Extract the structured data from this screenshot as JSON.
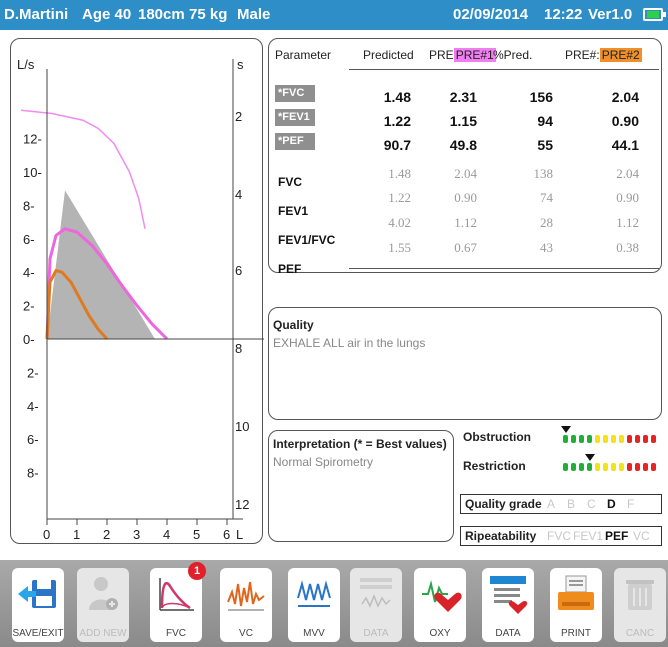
{
  "header": {
    "patient_name": "D.Martini",
    "age": "Age 40",
    "height": "180cm",
    "weight": "75 kg",
    "sex": "Male",
    "date": "02/09/2014",
    "time": "12:22",
    "version": "Ver1.0"
  },
  "chart_data": {
    "type": "line",
    "left_axis": {
      "unit_label": "L/s",
      "ticks_upper": [
        "12-",
        "10-",
        "8-",
        "6-",
        "4-",
        "2-",
        "0-"
      ],
      "ticks_lower": [
        "2-",
        "4-",
        "6-",
        "8-"
      ]
    },
    "right_axis": {
      "unit_label": "s",
      "ticks": [
        "2",
        "4",
        "6",
        "8",
        "10",
        "12"
      ]
    },
    "x_axis": {
      "ticks": [
        "0",
        "1",
        "2",
        "3",
        "4",
        "5",
        "6"
      ],
      "unit_label": "L"
    },
    "xlim": [
      0,
      6.5
    ],
    "ylim": [
      -10,
      14
    ],
    "series": [
      {
        "kind": "volume-time",
        "color": "#f08cf0",
        "x": [
          0,
          0.5,
          1,
          1.5,
          2,
          2.5,
          3,
          3.5,
          3.8,
          4.0
        ],
        "y": [
          13.7,
          13.6,
          13.5,
          13.3,
          13.1,
          12.6,
          11.7,
          10.0,
          8.4,
          6.6
        ]
      },
      {
        "kind": "predicted-area",
        "color": "#b4b4b4",
        "x": [
          0,
          0.6,
          3.6
        ],
        "y": [
          0,
          8.9,
          0
        ]
      },
      {
        "kind": "flow-volume-pre1",
        "color": "#ee66dd",
        "x": [
          0,
          0.1,
          0.3,
          0.6,
          1.0,
          1.5,
          2.0,
          2.5,
          3.0,
          3.5,
          4.0
        ],
        "y": [
          0,
          4.8,
          6.2,
          6.6,
          6.4,
          5.6,
          4.5,
          3.2,
          2.0,
          0.9,
          0
        ]
      },
      {
        "kind": "flow-volume-pre2",
        "color": "#e07a20",
        "x": [
          0,
          0.1,
          0.3,
          0.5,
          0.8,
          1.1,
          1.4,
          1.7,
          2.0
        ],
        "y": [
          0,
          3.4,
          4.1,
          4.0,
          3.4,
          2.4,
          1.4,
          0.6,
          0
        ]
      }
    ]
  },
  "table": {
    "headers": {
      "parameter": "Parameter",
      "predicted": "Predicted",
      "pre_prefix": "PRE",
      "pre1": "PRE#1",
      "pct_pred": "%Pred.",
      "pre_hash_prefix": "PRE#:",
      "pre2": "PRE#2"
    },
    "rows_best": [
      {
        "label": "*FVC",
        "predicted": "1.48",
        "pre1": "2.31",
        "pct": "156",
        "pre2": "2.04"
      },
      {
        "label": "*FEV1",
        "predicted": "1.22",
        "pre1": "1.15",
        "pct": "94",
        "pre2": "0.90"
      },
      {
        "label": "*PEF",
        "predicted": "90.7",
        "pre1": "49.8",
        "pct": "55",
        "pre2": "44.1"
      }
    ],
    "rows_other_labels": [
      "FVC",
      "FEV1",
      "FEV1/FVC",
      "PEF"
    ],
    "rows_other": [
      {
        "predicted": "1.48",
        "pre1": "2.04",
        "pct": "138",
        "pre2": "2.04"
      },
      {
        "predicted": "1.22",
        "pre1": "0.90",
        "pct": "74",
        "pre2": "0.90"
      },
      {
        "predicted": "4.02",
        "pre1": "1.12",
        "pct": "28",
        "pre2": "1.12"
      },
      {
        "predicted": "1.55",
        "pre1": "0.67",
        "pct": "43",
        "pre2": "0.38"
      }
    ]
  },
  "quality": {
    "title": "Quality",
    "message": "EXHALE ALL air in the lungs"
  },
  "interpretation": {
    "title": "Interpretation (* = Best values)",
    "message": "Normal Spirometry"
  },
  "indicators": {
    "obstruction_label": "Obstruction",
    "restriction_label": "Restriction",
    "obstruction_level": 0.0,
    "restriction_level": 0.25,
    "colors": [
      "#1fae3a",
      "#1fae3a",
      "#1fae3a",
      "#1fae3a",
      "#f2e21a",
      "#f2e21a",
      "#f2e21a",
      "#f2e21a",
      "#e52424",
      "#e52424",
      "#e52424",
      "#e52424"
    ]
  },
  "quality_grade": {
    "label": "Quality grade",
    "grades": [
      "A",
      "B",
      "C",
      "D",
      "F"
    ],
    "selected": "D"
  },
  "repeatability": {
    "label": "Ripeatability",
    "items": [
      "FVC",
      "FEV1",
      "PEF",
      "VC"
    ],
    "selected": "PEF"
  },
  "toolbar": {
    "buttons": [
      {
        "label": "SAVE/EXIT",
        "icon": "save-exit-icon",
        "enabled": true
      },
      {
        "label": "ADD NEW",
        "icon": "add-user-icon",
        "enabled": false
      },
      {
        "label": "FVC",
        "icon": "fvc-curve-icon",
        "enabled": true
      },
      {
        "label": "VC",
        "icon": "vc-wave-icon",
        "enabled": true
      },
      {
        "label": "MVV",
        "icon": "mvv-wave-icon",
        "enabled": true
      },
      {
        "label": "DATA",
        "icon": "data-wave-icon",
        "enabled": false
      },
      {
        "label": "OXY",
        "icon": "oxy-heart-icon",
        "enabled": true
      },
      {
        "label": "DATA",
        "icon": "data-heart-icon",
        "enabled": true
      },
      {
        "label": "PRINT",
        "icon": "printer-icon",
        "enabled": true
      },
      {
        "label": "CANC",
        "icon": "trash-icon",
        "enabled": false
      }
    ],
    "fvc_badge": "1"
  }
}
